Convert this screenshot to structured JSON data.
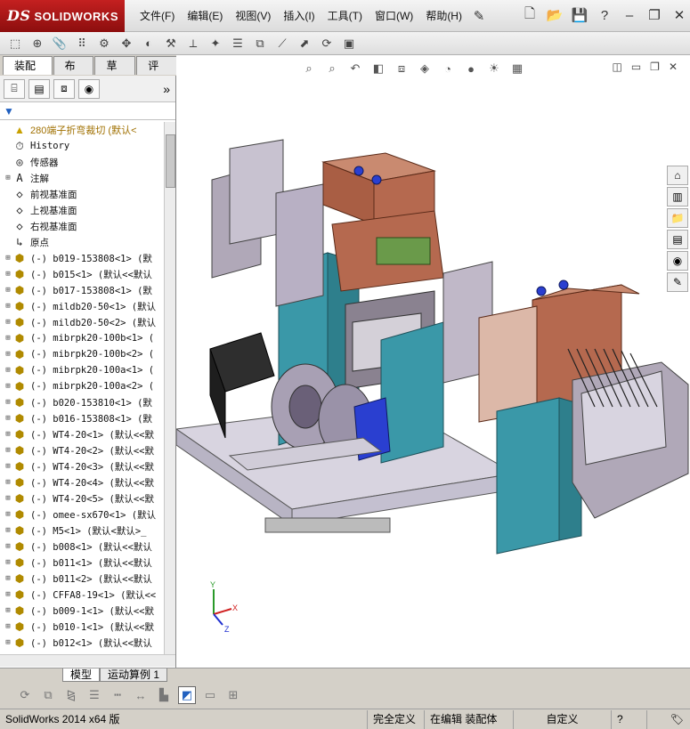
{
  "app": {
    "brand": "SOLIDWORKS",
    "brand_prefix": "DS"
  },
  "menu": [
    {
      "label": "文件(F)"
    },
    {
      "label": "编辑(E)"
    },
    {
      "label": "视图(V)"
    },
    {
      "label": "插入(I)"
    },
    {
      "label": "工具(T)"
    },
    {
      "label": "窗口(W)"
    },
    {
      "label": "帮助(H)"
    }
  ],
  "tabs": [
    {
      "label": "装配体",
      "active": true
    },
    {
      "label": "布局",
      "active": false
    },
    {
      "label": "草图",
      "active": false
    },
    {
      "label": "评估",
      "active": false
    }
  ],
  "tree": {
    "root": "280端子折弯裁切  (默认<",
    "items": [
      {
        "label": "History",
        "icon": "history-icon",
        "exp": ""
      },
      {
        "label": "传感器",
        "icon": "sensor-icon",
        "exp": ""
      },
      {
        "label": "注解",
        "icon": "annotation-icon",
        "exp": "+"
      },
      {
        "label": "前视基准面",
        "icon": "plane-icon",
        "exp": ""
      },
      {
        "label": "上视基准面",
        "icon": "plane-icon",
        "exp": ""
      },
      {
        "label": "右视基准面",
        "icon": "plane-icon",
        "exp": ""
      },
      {
        "label": "原点",
        "icon": "origin-icon",
        "exp": ""
      },
      {
        "label": "(-) b019-153808<1> (默",
        "icon": "part-icon",
        "exp": "+"
      },
      {
        "label": "(-) b015<1> (默认<<默认",
        "icon": "part-icon",
        "exp": "+"
      },
      {
        "label": "(-) b017-153808<1> (默",
        "icon": "part-icon",
        "exp": "+"
      },
      {
        "label": "(-) mildb20-50<1> (默认",
        "icon": "part-icon",
        "exp": "+"
      },
      {
        "label": "(-) mildb20-50<2> (默认",
        "icon": "part-icon",
        "exp": "+"
      },
      {
        "label": "(-) mibrpk20-100b<1> (",
        "icon": "part-icon",
        "exp": "+"
      },
      {
        "label": "(-) mibrpk20-100b<2> (",
        "icon": "part-icon",
        "exp": "+"
      },
      {
        "label": "(-) mibrpk20-100a<1> (",
        "icon": "part-icon",
        "exp": "+"
      },
      {
        "label": "(-) mibrpk20-100a<2> (",
        "icon": "part-icon",
        "exp": "+"
      },
      {
        "label": "(-) b020-153810<1> (默",
        "icon": "part-icon",
        "exp": "+"
      },
      {
        "label": "(-) b016-153808<1> (默",
        "icon": "part-icon",
        "exp": "+"
      },
      {
        "label": "(-) WT4-20<1> (默认<<默",
        "icon": "part-icon",
        "exp": "+"
      },
      {
        "label": "(-) WT4-20<2> (默认<<默",
        "icon": "part-icon",
        "exp": "+"
      },
      {
        "label": "(-) WT4-20<3> (默认<<默",
        "icon": "part-icon",
        "exp": "+"
      },
      {
        "label": "(-) WT4-20<4> (默认<<默",
        "icon": "part-icon",
        "exp": "+"
      },
      {
        "label": "(-) WT4-20<5> (默认<<默",
        "icon": "part-icon",
        "exp": "+"
      },
      {
        "label": "(-) omee-sx670<1> (默认",
        "icon": "part-icon",
        "exp": "+"
      },
      {
        "label": "(-) M5<1> (默认<默认>_",
        "icon": "part-icon",
        "exp": "+"
      },
      {
        "label": "(-) b008<1> (默认<<默认",
        "icon": "part-icon",
        "exp": "+"
      },
      {
        "label": "(-) b011<1> (默认<<默认",
        "icon": "part-icon",
        "exp": "+"
      },
      {
        "label": "(-) b011<2> (默认<<默认",
        "icon": "part-icon",
        "exp": "+"
      },
      {
        "label": "(-) CFFA8-19<1> (默认<<",
        "icon": "part-icon",
        "exp": "+"
      },
      {
        "label": "(-) b009-1<1> (默认<<默",
        "icon": "part-icon",
        "exp": "+"
      },
      {
        "label": "(-) b010-1<1> (默认<<默",
        "icon": "part-icon",
        "exp": "+"
      },
      {
        "label": "(-) b012<1> (默认<<默认",
        "icon": "part-icon",
        "exp": "+"
      }
    ]
  },
  "bottom_tabs": [
    {
      "label": "模型",
      "active": true
    },
    {
      "label": "运动算例 1",
      "active": false
    }
  ],
  "status": {
    "version": "SolidWorks 2014 x64 版",
    "state": "完全定义",
    "mode": "在编辑 装配体",
    "custom": "自定义"
  },
  "colors": {
    "accent": "#c42020",
    "frame": "#3a98a8",
    "copper": "#b5694f",
    "panel": "#b0a8b8",
    "motor": "#2e2e2e",
    "blue": "#2a3fd0"
  }
}
